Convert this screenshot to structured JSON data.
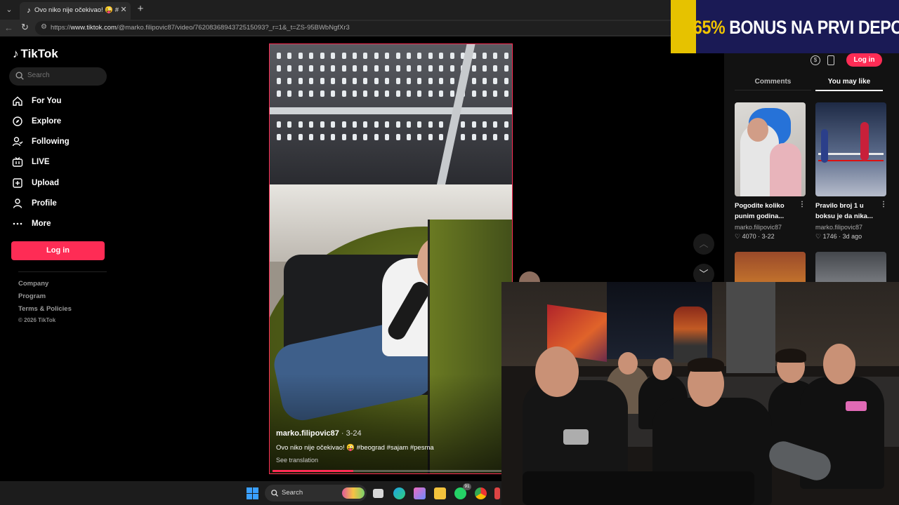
{
  "browser": {
    "tab_title": "Ovo niko nije očekivao! 😜 #beog",
    "url_prefix": "https://",
    "url_host": "www.tiktok.com",
    "url_path": "/@marko.filipovic87/video/7620836894372515093?_r=1&_t=ZS-95BWbNgfXr3"
  },
  "ad": {
    "percent": "65%",
    "text": " BONUS NA PRVI DEPOZIT"
  },
  "sidebar": {
    "logo": "TikTok",
    "search_placeholder": "Search",
    "nav": [
      {
        "label": "For You",
        "icon": "home-icon"
      },
      {
        "label": "Explore",
        "icon": "compass-icon"
      },
      {
        "label": "Following",
        "icon": "following-icon"
      },
      {
        "label": "LIVE",
        "icon": "live-icon"
      },
      {
        "label": "Upload",
        "icon": "upload-icon"
      },
      {
        "label": "Profile",
        "icon": "profile-icon"
      },
      {
        "label": "More",
        "icon": "more-icon"
      }
    ],
    "login": "Log in",
    "footer": [
      "Company",
      "Program",
      "Terms & Policies"
    ],
    "copyright": "© 2026 TikTok"
  },
  "video": {
    "author": "marko.filipovic87",
    "date": " · 3-24",
    "caption": "Ovo niko nije očekivao! 😜 #beograd #sajam #pesma",
    "translate": "See translation",
    "progress": 0.34
  },
  "right_panel": {
    "login": "Log in",
    "tabs": [
      "Comments",
      "You may like"
    ],
    "items": [
      {
        "title": "Pogodite koliko punim godina...",
        "author": "marko.filipovic87",
        "likes": "4070",
        "date": "3-22"
      },
      {
        "title": "Pravilo broj 1 u boksu je da nika...",
        "author": "marko.filipovic87",
        "likes": "1746",
        "date": "3d ago"
      }
    ]
  },
  "taskbar": {
    "search_label": "Search",
    "badge": "91"
  }
}
